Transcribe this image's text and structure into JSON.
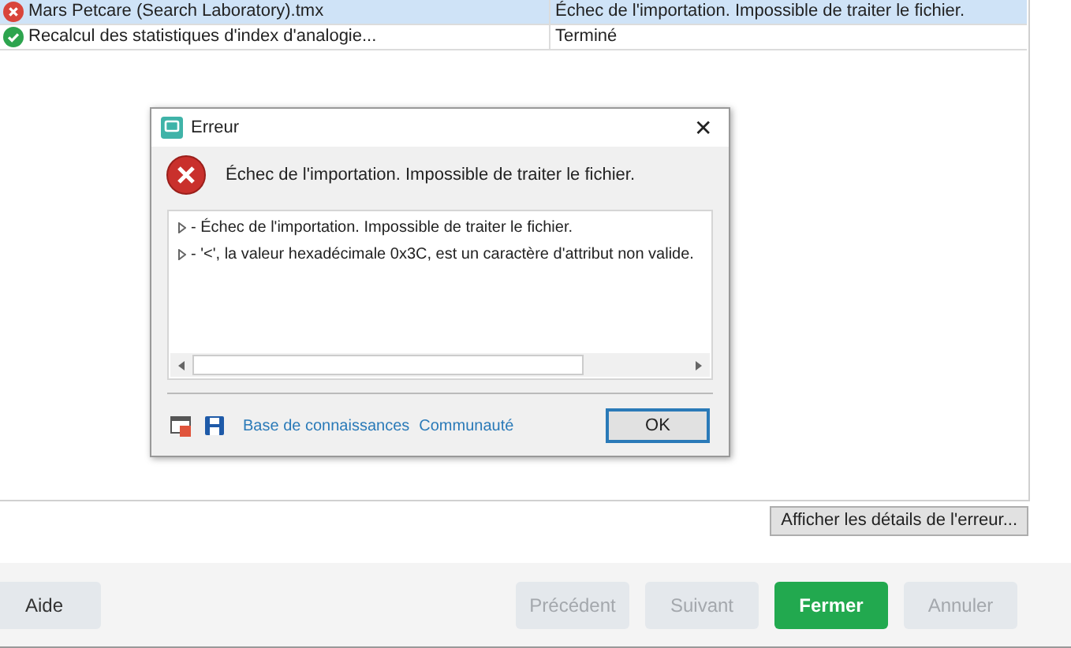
{
  "tasks": {
    "rows": [
      {
        "name": "Mars Petcare (Search Laboratory).tmx",
        "status": "Échec de l'importation. Impossible de traiter le fichier.",
        "kind": "error",
        "selected": true
      },
      {
        "name": "Recalcul des statistiques d'index d'analogie...",
        "status": "Terminé",
        "kind": "success",
        "selected": false
      }
    ]
  },
  "details_button": "Afficher les détails de l'erreur...",
  "footer": {
    "buttons": [
      {
        "label": "Aide",
        "kind": "plain",
        "disabled": false
      },
      {
        "label": "Précédent",
        "kind": "plain",
        "disabled": true
      },
      {
        "label": "Suivant",
        "kind": "plain",
        "disabled": true
      },
      {
        "label": "Fermer",
        "kind": "primary",
        "disabled": false
      },
      {
        "label": "Annuler",
        "kind": "plain",
        "disabled": true
      }
    ]
  },
  "dialog": {
    "title": "Erreur",
    "close": "✕",
    "message": "Échec de l'importation. Impossible de traiter le fichier.",
    "details": [
      {
        "text": "- Échec de l'importation. Impossible de traiter le fichier.",
        "expanded": false
      },
      {
        "text": "- '<', la valeur hexadécimale 0x3C, est un caractère d'attribut non valide.",
        "expanded": false
      }
    ],
    "links": [
      "Base de connaissances",
      "Communauté"
    ],
    "ok": "OK"
  }
}
